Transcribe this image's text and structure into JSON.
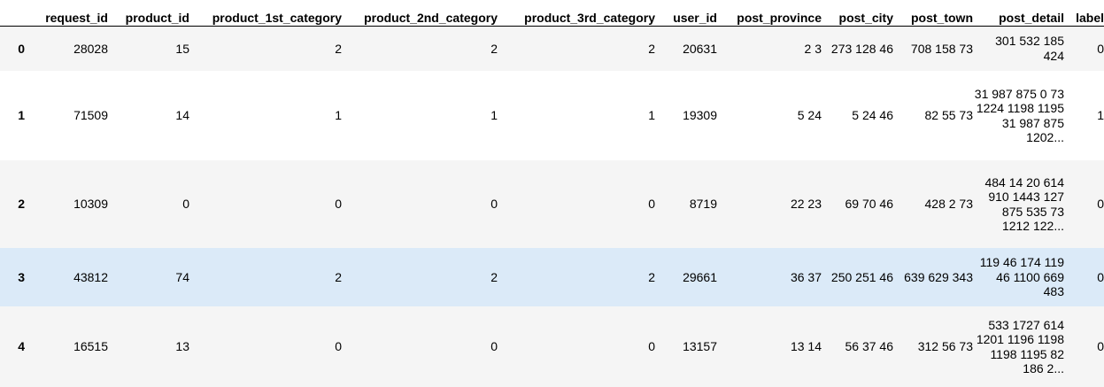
{
  "table": {
    "columns": [
      "",
      "request_id",
      "product_id",
      "product_1st_category",
      "product_2nd_category",
      "product_3rd_category",
      "user_id",
      "post_province",
      "post_city",
      "post_town",
      "post_detail",
      "label"
    ],
    "rows": [
      {
        "index": "0",
        "request_id": "28028",
        "product_id": "15",
        "product_1st_category": "2",
        "product_2nd_category": "2",
        "product_3rd_category": "2",
        "user_id": "20631",
        "post_province": "2 3",
        "post_city": "273 128 46",
        "post_town": "708 158 73",
        "post_detail": "301 532 185 424",
        "label": "0"
      },
      {
        "index": "1",
        "request_id": "71509",
        "product_id": "14",
        "product_1st_category": "1",
        "product_2nd_category": "1",
        "product_3rd_category": "1",
        "user_id": "19309",
        "post_province": "5 24",
        "post_city": "5 24 46",
        "post_town": "82 55 73",
        "post_detail": "31 987 875 0 73 1224 1198 1195 31 987 875 1202...",
        "label": "1"
      },
      {
        "index": "2",
        "request_id": "10309",
        "product_id": "0",
        "product_1st_category": "0",
        "product_2nd_category": "0",
        "product_3rd_category": "0",
        "user_id": "8719",
        "post_province": "22 23",
        "post_city": "69 70 46",
        "post_town": "428 2 73",
        "post_detail": "484 14 20 614 910 1443 127 875 535 73 1212 122...",
        "label": "0"
      },
      {
        "index": "3",
        "request_id": "43812",
        "product_id": "74",
        "product_1st_category": "2",
        "product_2nd_category": "2",
        "product_3rd_category": "2",
        "user_id": "29661",
        "post_province": "36 37",
        "post_city": "250 251 46",
        "post_town": "639 629 343",
        "post_detail": "119 46 174 119 46 1100 669 483",
        "label": "0"
      },
      {
        "index": "4",
        "request_id": "16515",
        "product_id": "13",
        "product_1st_category": "0",
        "product_2nd_category": "0",
        "product_3rd_category": "0",
        "user_id": "13157",
        "post_province": "13 14",
        "post_city": "56 37 46",
        "post_town": "312 56 73",
        "post_detail": "533 1727 614 1201 1196 1198 1198 1195 82 186 2...",
        "label": "0"
      }
    ]
  }
}
